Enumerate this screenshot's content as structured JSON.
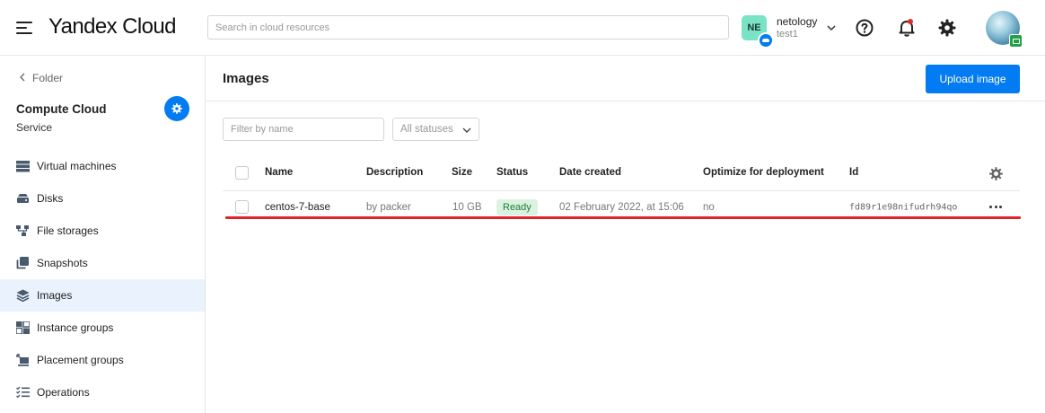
{
  "header": {
    "logo_bold": "Yandex",
    "logo_light": "Cloud",
    "search_placeholder": "Search in cloud resources",
    "account": {
      "badge": "NE",
      "name": "netology",
      "sub": "test1"
    }
  },
  "sidebar": {
    "back_label": "Folder",
    "service_title": "Compute Cloud",
    "service_sub": "Service",
    "items": [
      {
        "label": "Virtual machines",
        "icon": "server-icon"
      },
      {
        "label": "Disks",
        "icon": "disk-icon"
      },
      {
        "label": "File storages",
        "icon": "file-storage-icon"
      },
      {
        "label": "Snapshots",
        "icon": "snapshot-icon"
      },
      {
        "label": "Images",
        "icon": "layers-icon",
        "active": true
      },
      {
        "label": "Instance groups",
        "icon": "instance-groups-icon"
      },
      {
        "label": "Placement groups",
        "icon": "placement-groups-icon"
      },
      {
        "label": "Operations",
        "icon": "operations-icon"
      }
    ]
  },
  "main": {
    "title": "Images",
    "upload_label": "Upload image",
    "filter_placeholder": "Filter by name",
    "status_select": "All statuses",
    "columns": [
      "Name",
      "Description",
      "Size",
      "Status",
      "Date created",
      "Optimize for deployment",
      "Id"
    ],
    "rows": [
      {
        "name": "centos-7-base",
        "description": "by packer",
        "size": "10 GB",
        "status": "Ready",
        "date_created": "02 February 2022, at 15:06",
        "optimize": "no",
        "id": "fd89r1e98nifudrh94qo"
      }
    ]
  },
  "colors": {
    "accent": "#027bf3",
    "status_ready_bg": "#dcf2e0",
    "status_ready_text": "#1f7a33",
    "highlight_line": "#e0242a",
    "active_nav_bg": "#e9f2fd"
  }
}
